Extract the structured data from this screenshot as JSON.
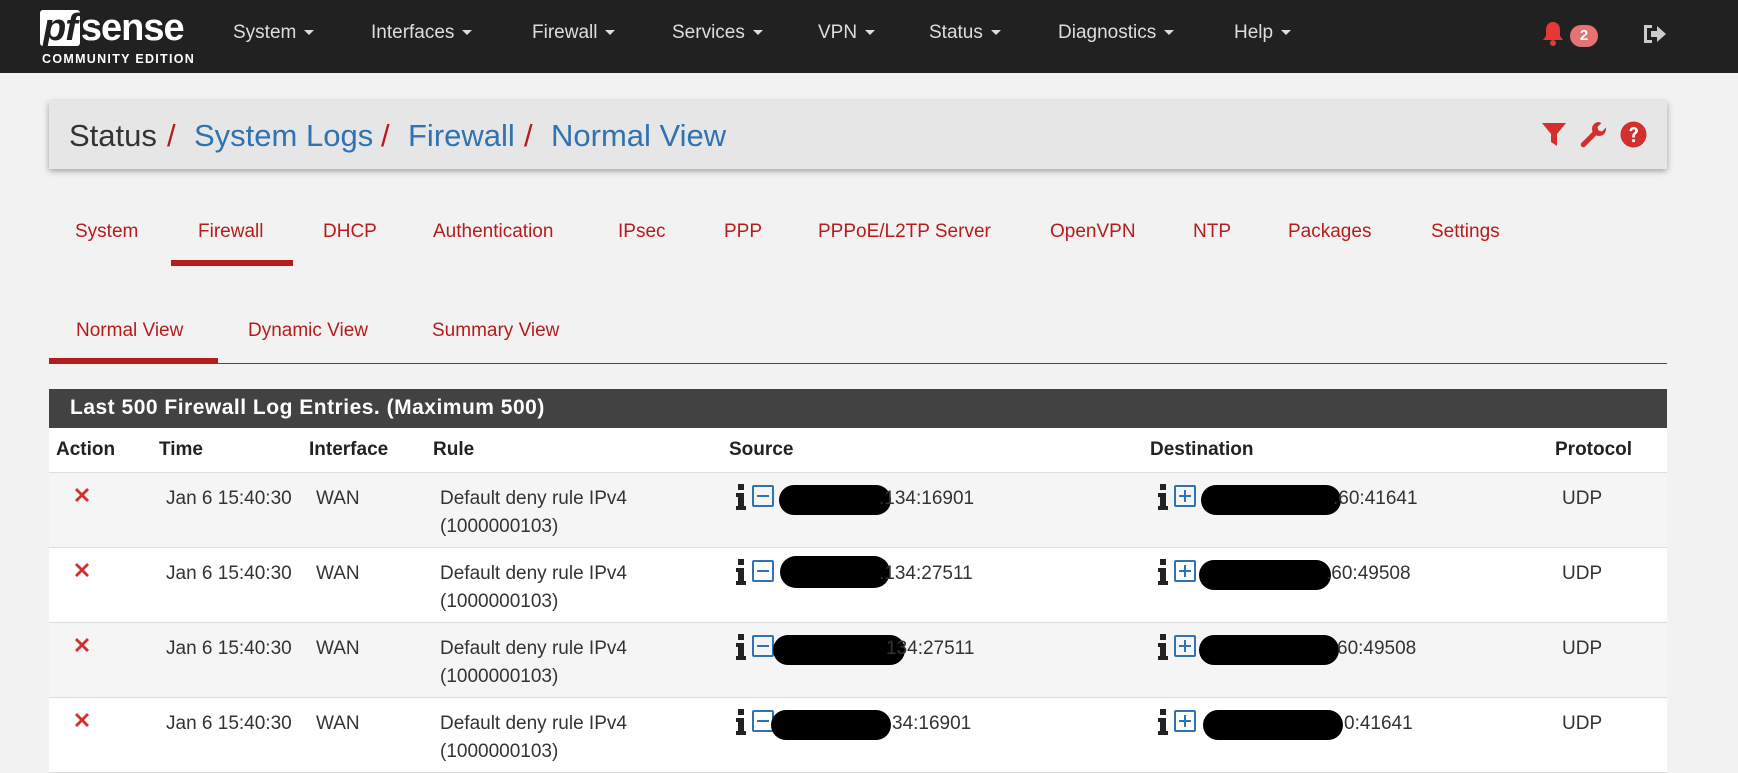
{
  "logo": {
    "main_prefix": "pf",
    "main_suffix": "sense",
    "sub": "COMMUNITY EDITION"
  },
  "nav": {
    "items": [
      "System",
      "Interfaces",
      "Firewall",
      "Services",
      "VPN",
      "Status",
      "Diagnostics",
      "Help"
    ],
    "notifications_count": "2"
  },
  "breadcrumb": {
    "root": "Status",
    "level1": "System Logs",
    "level2": "Firewall",
    "level3": "Normal View"
  },
  "tabs": [
    "System",
    "Firewall",
    "DHCP",
    "Authentication",
    "IPsec",
    "PPP",
    "PPPoE/L2TP Server",
    "OpenVPN",
    "NTP",
    "Packages",
    "Settings"
  ],
  "active_tab": "Firewall",
  "subtabs": [
    "Normal View",
    "Dynamic View",
    "Summary View"
  ],
  "active_subtab": "Normal View",
  "panel": {
    "title": "Last 500 Firewall Log Entries. (Maximum 500)",
    "columns": [
      "Action",
      "Time",
      "Interface",
      "Rule",
      "Source",
      "Destination",
      "Protocol"
    ]
  },
  "rows": [
    {
      "time": "Jan 6 15:40:30",
      "interface": "WAN",
      "rule_line1": "Default deny rule IPv4",
      "rule_line2": "(1000000103)",
      "source_visible": ".134:16901",
      "destination_visible": ".60:41641",
      "protocol": "UDP"
    },
    {
      "time": "Jan 6 15:40:30",
      "interface": "WAN",
      "rule_line1": "Default deny rule IPv4",
      "rule_line2": "(1000000103)",
      "source_visible": ".134:27511",
      "destination_visible": ".60:49508",
      "protocol": "UDP"
    },
    {
      "time": "Jan 6 15:40:30",
      "interface": "WAN",
      "rule_line1": "Default deny rule IPv4",
      "rule_line2": "(1000000103)",
      "source_visible": "134:27511",
      "destination_visible": "60:49508",
      "protocol": "UDP"
    },
    {
      "time": "Jan 6 15:40:30",
      "interface": "WAN",
      "rule_line1": "Default deny rule IPv4",
      "rule_line2": "(1000000103)",
      "source_visible": "34:16901",
      "destination_visible": "0:41641",
      "protocol": "UDP"
    }
  ],
  "colors": {
    "navbar": "#212121",
    "accent_red": "#b71c1c",
    "link_blue": "#2f73b3",
    "panel_head": "#424242"
  },
  "icons": [
    "bell-icon",
    "logout-icon",
    "filter-icon",
    "wrench-icon",
    "help-icon",
    "block-x-icon",
    "info-icon",
    "collapse-minus-icon",
    "expand-plus-icon"
  ]
}
